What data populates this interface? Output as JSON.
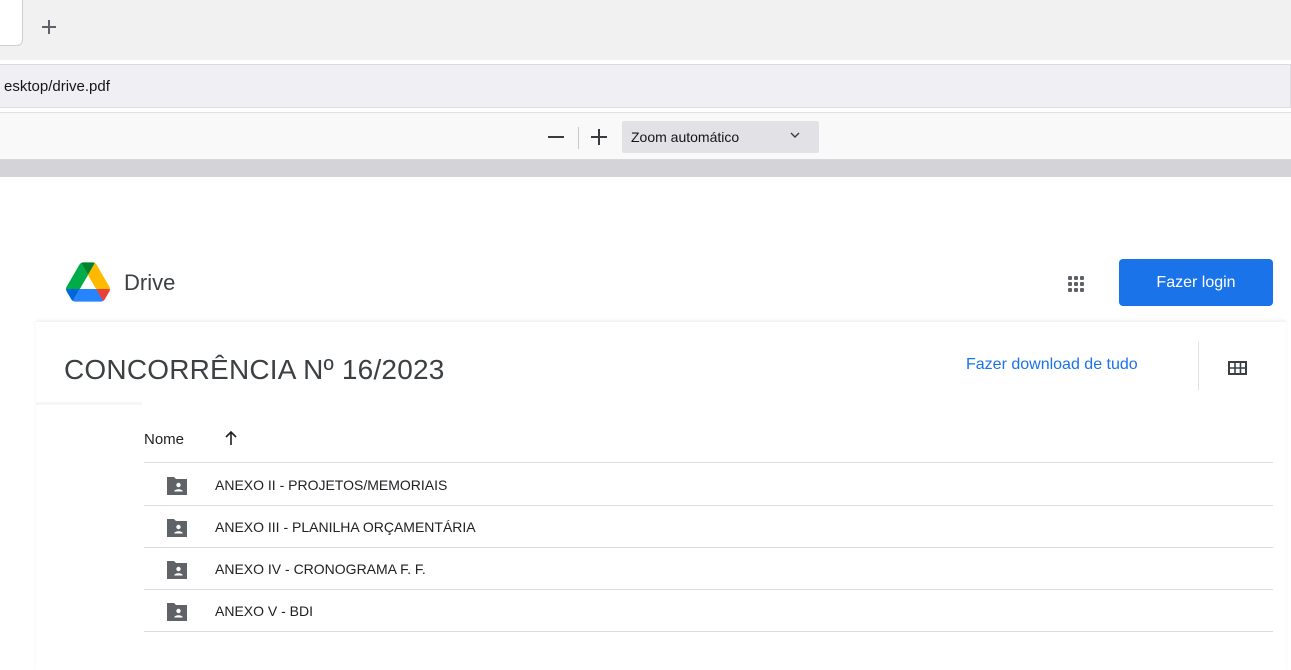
{
  "browser": {
    "new_tab_icon": "plus-icon",
    "url": "esktop/drive.pdf"
  },
  "pdf_toolbar": {
    "zoom_out_icon": "minus-icon",
    "zoom_in_icon": "plus-icon",
    "zoom_value": "Zoom automático",
    "zoom_dropdown_icon": "chevron-down-icon"
  },
  "drive_header": {
    "logo_icon": "google-drive-logo-icon",
    "app_name": "Drive",
    "apps_icon": "apps-grid-icon",
    "login_label": "Fazer login",
    "colors": {
      "accent": "#1a73e8"
    }
  },
  "folder": {
    "title": "CONCORRÊNCIA Nº 16/2023",
    "download_all_label": "Fazer download de tudo",
    "view_icon": "grid-view-icon",
    "column_name": "Nome",
    "sort_icon": "arrow-up-icon",
    "items": [
      {
        "label": "ANEXO II - PROJETOS/MEMORIAIS",
        "icon": "shared-folder-icon"
      },
      {
        "label": "ANEXO III - PLANILHA ORÇAMENTÁRIA",
        "icon": "shared-folder-icon"
      },
      {
        "label": "ANEXO IV - CRONOGRAMA F. F.",
        "icon": "shared-folder-icon"
      },
      {
        "label": "ANEXO V - BDI",
        "icon": "shared-folder-icon"
      }
    ]
  }
}
